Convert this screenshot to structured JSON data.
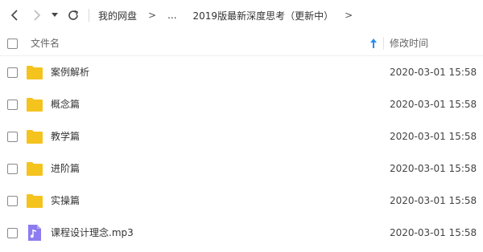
{
  "toolbar": {
    "breadcrumbs": [
      "我的网盘",
      "...",
      "2019版最新深度思考（更新中）"
    ],
    "separator": ">"
  },
  "header": {
    "name_label": "文件名",
    "time_label": "修改时间",
    "sort_direction": "ascending"
  },
  "files": [
    {
      "name": "案例解析",
      "time": "2020-03-01 15:58",
      "type": "folder"
    },
    {
      "name": "概念篇",
      "time": "2020-03-01 15:58",
      "type": "folder"
    },
    {
      "name": "教学篇",
      "time": "2020-03-01 15:58",
      "type": "folder"
    },
    {
      "name": "进阶篇",
      "time": "2020-03-01 15:58",
      "type": "folder"
    },
    {
      "name": "实操篇",
      "time": "2020-03-01 15:58",
      "type": "folder"
    },
    {
      "name": "课程设计理念.mp3",
      "time": "2020-03-01 15:58",
      "type": "audio"
    }
  ],
  "colors": {
    "folder": "#f5c31e",
    "audio": "#8c7cf0",
    "sort_arrow": "#2a8ef0"
  }
}
